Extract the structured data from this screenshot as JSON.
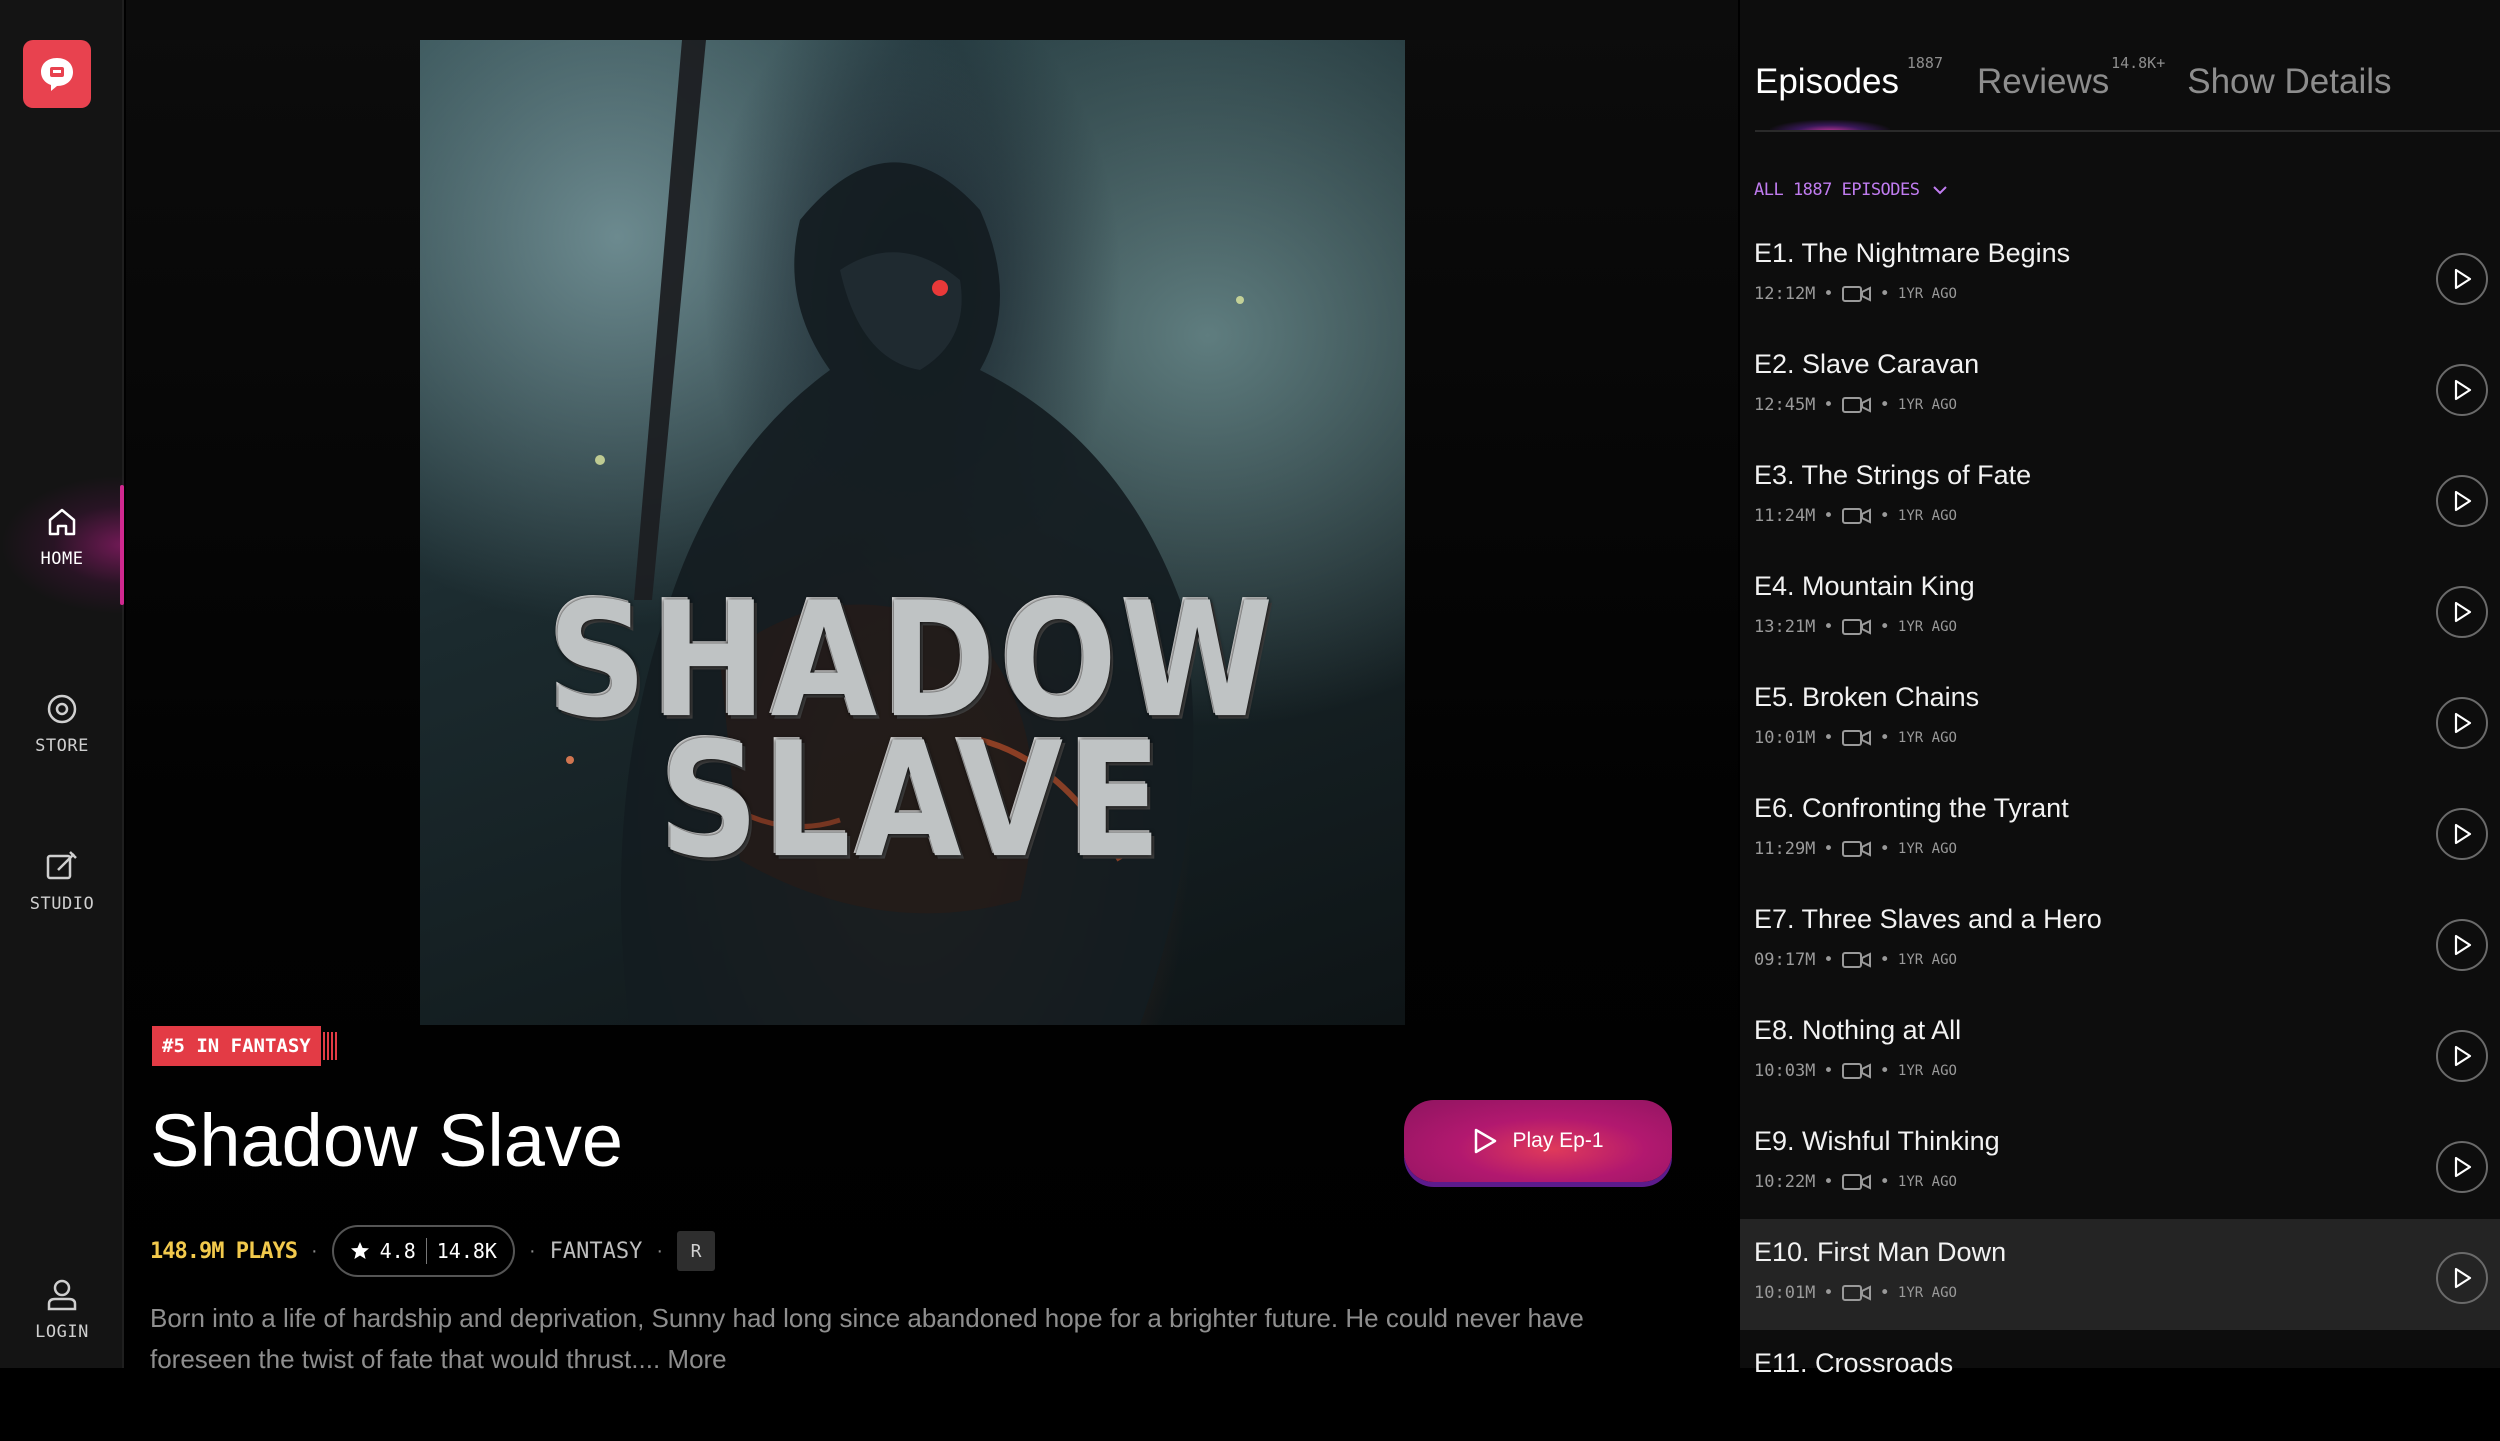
{
  "sidebar": {
    "nav": [
      {
        "label": "HOME",
        "icon": "home-icon",
        "active": true
      },
      {
        "label": "STORE",
        "icon": "store-icon",
        "active": false
      },
      {
        "label": "STUDIO",
        "icon": "studio-icon",
        "active": false
      },
      {
        "label": "LOGIN",
        "icon": "user-icon",
        "active": false
      }
    ]
  },
  "show": {
    "cover_title_line1": "SHADOW",
    "cover_title_line2": "SLAVE",
    "rank_badge": "#5 IN FANTASY",
    "title": "Shadow Slave",
    "play_label": "Play Ep-1",
    "plays": "148.9M PLAYS",
    "rating": "4.8",
    "rating_count": "14.8K",
    "genre": "FANTASY",
    "age_rating": "R",
    "description": "Born into a life of hardship and deprivation, Sunny had long since abandoned hope for a brighter future. He could never have foreseen the twist of fate that would thrust....",
    "more_label": "More"
  },
  "panel": {
    "tabs": [
      {
        "label": "Episodes",
        "count": "1887",
        "active": true
      },
      {
        "label": "Reviews",
        "count": "14.8K+",
        "active": false
      },
      {
        "label": "Show Details",
        "count": "",
        "active": false
      }
    ],
    "filter_label": "ALL 1887 EPISODES",
    "episodes": [
      {
        "title": "E1. The Nightmare Begins",
        "duration": "12:12M",
        "ago": "1YR AGO"
      },
      {
        "title": "E2. Slave Caravan",
        "duration": "12:45M",
        "ago": "1YR AGO"
      },
      {
        "title": "E3. The Strings of Fate",
        "duration": "11:24M",
        "ago": "1YR AGO"
      },
      {
        "title": "E4. Mountain King",
        "duration": "13:21M",
        "ago": "1YR AGO"
      },
      {
        "title": "E5. Broken Chains",
        "duration": "10:01M",
        "ago": "1YR AGO"
      },
      {
        "title": "E6. Confronting the Tyrant",
        "duration": "11:29M",
        "ago": "1YR AGO"
      },
      {
        "title": "E7. Three Slaves and a Hero",
        "duration": "09:17M",
        "ago": "1YR AGO"
      },
      {
        "title": "E8. Nothing at All",
        "duration": "10:03M",
        "ago": "1YR AGO"
      },
      {
        "title": "E9. Wishful Thinking",
        "duration": "10:22M",
        "ago": "1YR AGO"
      },
      {
        "title": "E10. First Man Down",
        "duration": "10:01M",
        "ago": "1YR AGO"
      },
      {
        "title": "E11. Crossroads",
        "duration": "",
        "ago": ""
      }
    ]
  },
  "colors": {
    "accent_pink": "#d0288f",
    "badge_red": "#e33b45",
    "plays_yellow": "#f2c94c",
    "filter_purple": "#c07cf0"
  }
}
